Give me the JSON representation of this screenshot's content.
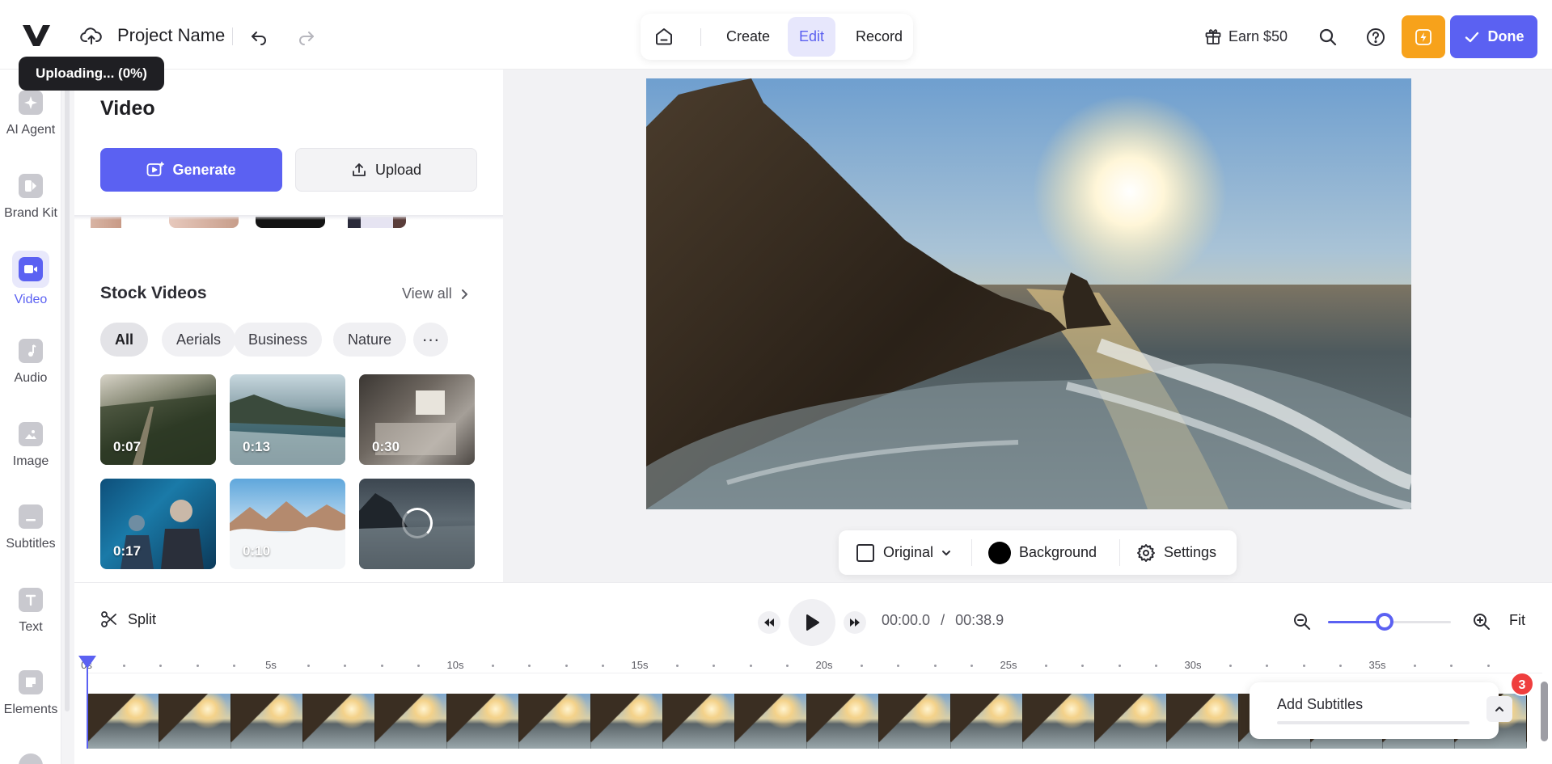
{
  "header": {
    "project_name": "Project Name",
    "upload_tooltip": "Uploading... (0%)",
    "modes": [
      "Create",
      "Edit",
      "Record"
    ],
    "active_mode": "Edit",
    "earn_label": "Earn $50",
    "done_label": "Done",
    "icons": [
      "logo-v",
      "cloud-upload-icon",
      "undo-icon",
      "redo-icon",
      "home-icon",
      "gift-icon",
      "search-icon",
      "help-icon",
      "bolt-icon",
      "check-icon"
    ]
  },
  "sidebar": {
    "items": [
      {
        "label": "AI Agent",
        "icon": "sparkle-icon"
      },
      {
        "label": "Brand Kit",
        "icon": "brand-kit-icon"
      },
      {
        "label": "Video",
        "icon": "video-icon",
        "active": true
      },
      {
        "label": "Audio",
        "icon": "music-note-icon"
      },
      {
        "label": "Image",
        "icon": "image-icon"
      },
      {
        "label": "Subtitles",
        "icon": "subtitles-icon"
      },
      {
        "label": "Text",
        "icon": "text-icon"
      },
      {
        "label": "Elements",
        "icon": "elements-icon"
      }
    ]
  },
  "panel": {
    "title": "Video",
    "generate_label": "Generate",
    "upload_label": "Upload",
    "stock": {
      "title": "Stock Videos",
      "view_all": "View all",
      "chips": [
        "All",
        "Aerials",
        "Business",
        "Nature"
      ],
      "active_chip": "All",
      "more_label": "···",
      "videos": [
        {
          "duration": "0:07",
          "subject": "forest road aerial"
        },
        {
          "duration": "0:13",
          "subject": "rocky coastline"
        },
        {
          "duration": "0:30",
          "subject": "office desk"
        },
        {
          "duration": "0:17",
          "subject": "business meeting"
        },
        {
          "duration": "0:10",
          "subject": "mountains above clouds"
        },
        {
          "duration": "",
          "subject": "sea rock at sunset",
          "loading": true
        }
      ]
    }
  },
  "canvas_toolbar": {
    "aspect_label": "Original",
    "background_label": "Background",
    "background_color": "#000000",
    "settings_label": "Settings"
  },
  "timeline": {
    "split_label": "Split",
    "current_time": "00:00.0",
    "time_separator": "/",
    "total_time": "00:38.9",
    "fit_label": "Fit",
    "zoom_level": 0.46,
    "ruler_labels": [
      "0s",
      "5s",
      "10s",
      "15s",
      "20s",
      "25s",
      "30s",
      "35s"
    ],
    "subtitles": {
      "title": "Add Subtitles",
      "badge_count": "3"
    }
  },
  "colors": {
    "accent": "#5b61f2",
    "bolt": "#f7a21b",
    "badge": "#ef3e3e"
  }
}
